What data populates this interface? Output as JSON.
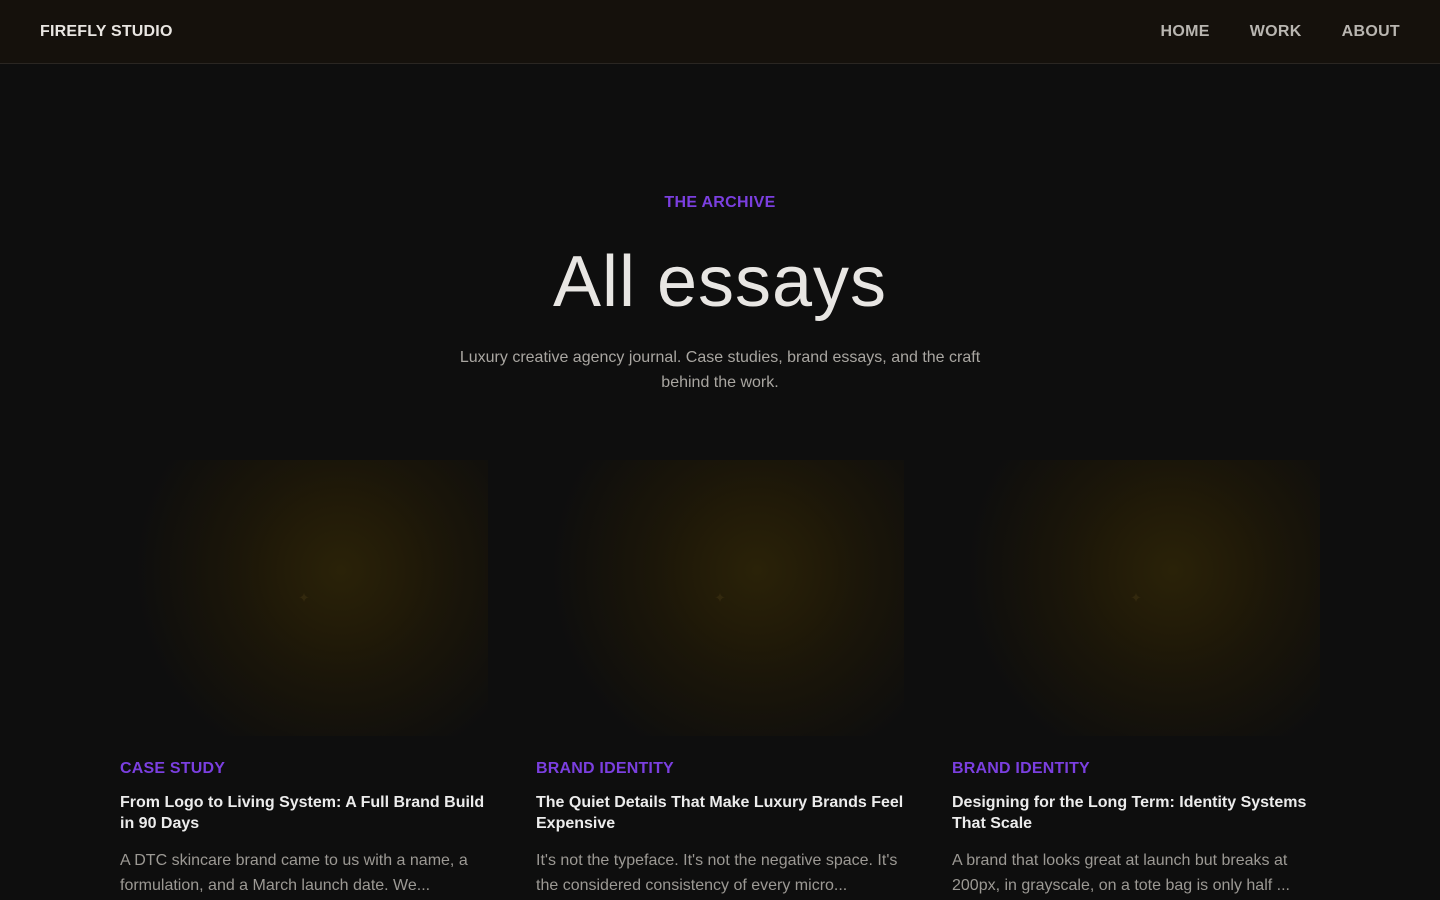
{
  "header": {
    "brand": "FIREFLY STUDIO",
    "nav": [
      "HOME",
      "WORK",
      "ABOUT"
    ]
  },
  "hero": {
    "eyebrow": "THE ARCHIVE",
    "title": "All essays",
    "subtitle": "Luxury creative agency journal. Case studies, brand essays, and the craft behind the work."
  },
  "cards": [
    {
      "tag": "CASE STUDY",
      "title": "From Logo to Living System: A Full Brand Build in 90 Days",
      "excerpt": "A DTC skincare brand came to us with a name, a formulation, and a March launch date. We..."
    },
    {
      "tag": "BRAND IDENTITY",
      "title": "The Quiet Details That Make Luxury Brands Feel Expensive",
      "excerpt": "It's not the typeface. It's not the negative space. It's the considered consistency of every micro..."
    },
    {
      "tag": "BRAND IDENTITY",
      "title": "Designing for the Long Term: Identity Systems That Scale",
      "excerpt": "A brand that looks great at launch but breaks at 200px, in grayscale, on a tote bag is only half ..."
    }
  ],
  "colors": {
    "accent": "#7b3fe0",
    "background": "#0e0e0e",
    "header_background": "#15110c"
  }
}
